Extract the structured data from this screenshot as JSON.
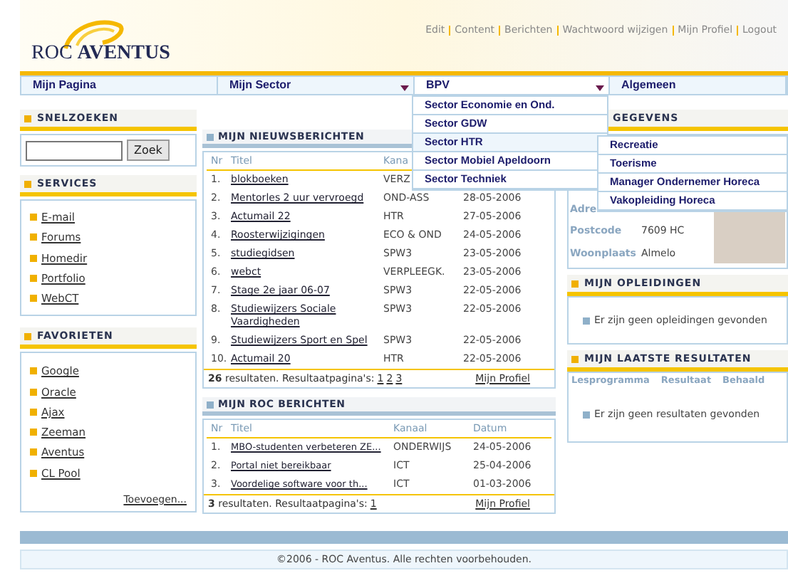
{
  "header": {
    "logo": {
      "prefix": "ROC",
      "name": "AVENTUS"
    },
    "top_links": [
      "Edit",
      "Content",
      "Berichten",
      "Wachtwoord wijzigen",
      "Mijn Profiel",
      "Logout"
    ]
  },
  "nav": [
    {
      "label": "Mijn Pagina",
      "has_menu": false,
      "expanded": false
    },
    {
      "label": "Mijn Sector",
      "has_menu": true,
      "expanded": false
    },
    {
      "label": "BPV",
      "has_menu": true,
      "expanded": true
    },
    {
      "label": "Algemeen",
      "has_menu": false,
      "expanded": false
    }
  ],
  "bpv_menu": {
    "items": [
      {
        "label": "Sector Economie en Ond.",
        "selected": false
      },
      {
        "label": "Sector GDW",
        "selected": false
      },
      {
        "label": "Sector HTR",
        "selected": true
      },
      {
        "label": "Sector Mobiel Apeldoorn",
        "selected": false
      },
      {
        "label": "Sector Techniek",
        "selected": false
      }
    ],
    "submenu": [
      "Recreatie",
      "Toerisme",
      "Manager Ondernemer Horeca",
      "Vakopleiding Horeca"
    ]
  },
  "snelzoeken": {
    "title": "SNELZOEKEN",
    "button": "Zoek"
  },
  "services": {
    "title": "SERVICES",
    "links": [
      "E-mail",
      "Forums",
      "Homedir",
      "Portfolio",
      "WebCT"
    ]
  },
  "favorieten": {
    "title": "FAVORIETEN",
    "links": [
      "Google",
      "Oracle",
      "Ajax",
      "Zeeman",
      "Aventus",
      "CL Pool"
    ],
    "add_link": "Toevoegen..."
  },
  "news": {
    "title": "MIJN NIEUWSBERICHTEN",
    "columns": [
      "Nr",
      "Titel",
      "Kana"
    ],
    "rows": [
      {
        "nr": "1.",
        "title": "blokboeken",
        "channel": "VERZ"
      },
      {
        "nr": "2.",
        "title": "Mentorles 2 uur vervroegd",
        "channel": "OND-ASS",
        "date": "28-05-2006"
      },
      {
        "nr": "3.",
        "title": "Actumail 22",
        "channel": "HTR",
        "date": "27-05-2006"
      },
      {
        "nr": "4.",
        "title": "Roosterwijzigingen",
        "channel": "ECO & OND",
        "date": "24-05-2006"
      },
      {
        "nr": "5.",
        "title": "studiegidsen",
        "channel": "SPW3",
        "date": "23-05-2006"
      },
      {
        "nr": "6.",
        "title": "webct",
        "channel": "VERPLEEGK.",
        "date": "23-05-2006"
      },
      {
        "nr": "7.",
        "title": "Stage 2e jaar 06-07",
        "channel": "SPW3",
        "date": "22-05-2006"
      },
      {
        "nr": "8.",
        "title": "Studiewijzers Sociale Vaardigheden",
        "channel": "SPW3",
        "date": "22-05-2006"
      },
      {
        "nr": "9.",
        "title": "Studiewijzers Sport en Spel",
        "channel": "SPW3",
        "date": "22-05-2006"
      },
      {
        "nr": "10.",
        "title": "Actumail 20",
        "channel": "HTR",
        "date": "22-05-2006"
      }
    ],
    "summary": "**26** resultaten. Resultaatpagina's:",
    "pages": [
      "1",
      "2",
      "3"
    ],
    "profile_link": "Mijn Profiel"
  },
  "roc": {
    "title": "MIJN ROC BERICHTEN",
    "columns": [
      "Nr",
      "Titel",
      "Kanaal",
      "Datum"
    ],
    "rows": [
      {
        "nr": "1.",
        "title": "MBO-studenten verbeteren ZE...",
        "channel": "ONDERWIJS",
        "date": "24-05-2006"
      },
      {
        "nr": "2.",
        "title": "Portal niet bereikbaar",
        "channel": "ICT",
        "date": "25-04-2006"
      },
      {
        "nr": "3.",
        "title": "Voordelige software voor th...",
        "channel": "ICT",
        "date": "01-03-2006"
      }
    ],
    "summary": "**3** resultaten. Resultaatpagina's:",
    "pages": [
      "1"
    ],
    "profile_link": "Mijn Profiel"
  },
  "gegevens": {
    "title": "GEGEVENS",
    "fields": [
      {
        "label": "Adre"
      },
      {
        "label": "Postcode",
        "value": "7609 HC"
      },
      {
        "label": "Woonplaats",
        "value": "Almelo"
      }
    ]
  },
  "opleidingen": {
    "title": "MIJN OPLEIDINGEN",
    "message": "Er zijn geen opleidingen gevonden"
  },
  "resultaten": {
    "title": "MIJN LAATSTE RESULTATEN",
    "columns": [
      "Lesprogramma",
      "Resultaat",
      "Behaald"
    ],
    "message": "Er zijn geen resultaten gevonden"
  },
  "footer": "©2006 - ROC Aventus. Alle rechten voorbehouden."
}
